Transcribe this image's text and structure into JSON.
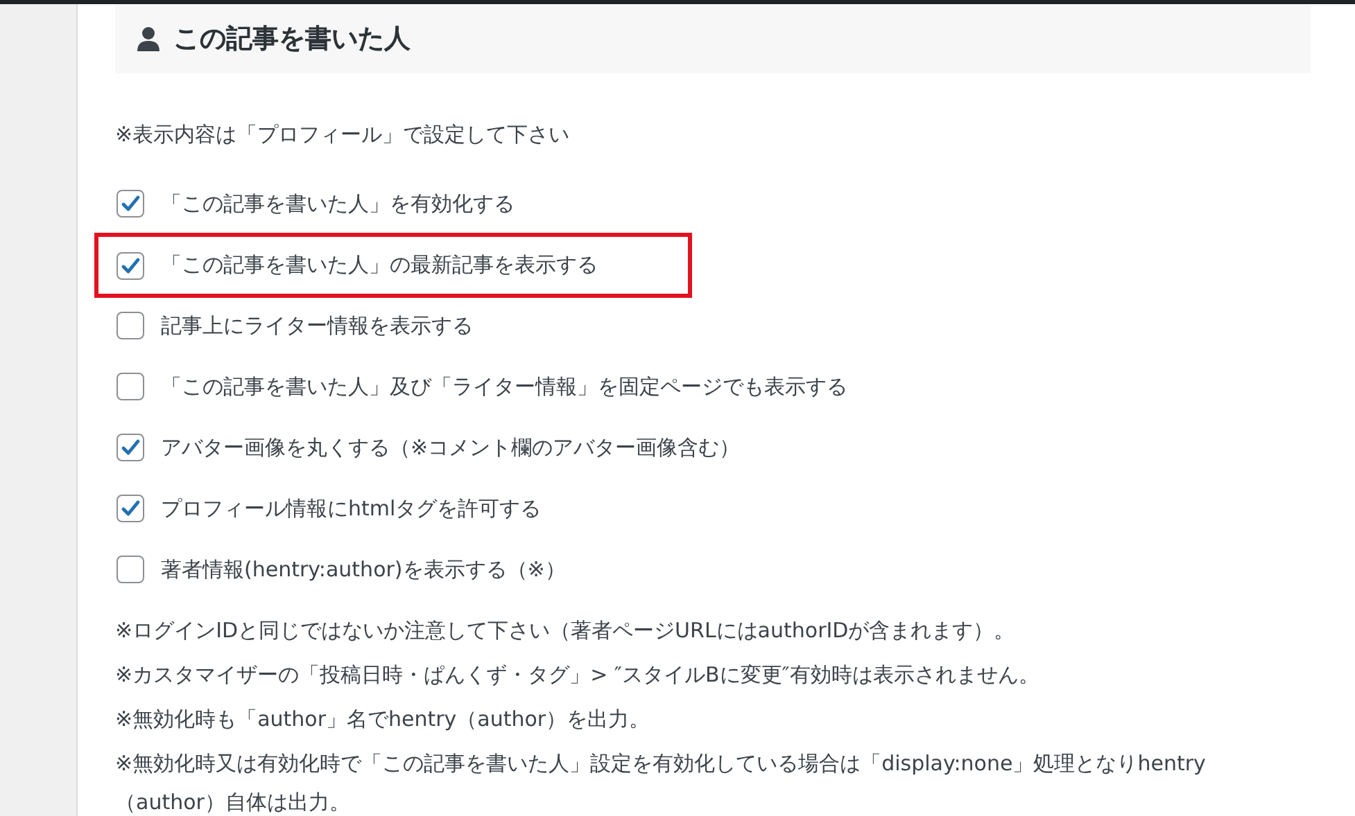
{
  "section": {
    "title": "この記事を書いた人"
  },
  "intro_note": "※表示内容は「プロフィール」で設定して下さい",
  "options": [
    {
      "label": "「この記事を書いた人」を有効化する",
      "checked": true,
      "highlighted": false
    },
    {
      "label": "「この記事を書いた人」の最新記事を表示する",
      "checked": true,
      "highlighted": true
    },
    {
      "label": "記事上にライター情報を表示する",
      "checked": false,
      "highlighted": false
    },
    {
      "label": "「この記事を書いた人」及び「ライター情報」を固定ページでも表示する",
      "checked": false,
      "highlighted": false
    },
    {
      "label": "アバター画像を丸くする（※コメント欄のアバター画像含む）",
      "checked": true,
      "highlighted": false
    },
    {
      "label": "プロフィール情報にhtmlタグを許可する",
      "checked": true,
      "highlighted": false
    },
    {
      "label": "著者情報(hentry:author)を表示する（※）",
      "checked": false,
      "highlighted": false
    }
  ],
  "notes": [
    "※ログインIDと同じではないか注意して下さい（著者ページURLにはauthorIDが含まれます）。",
    "※カスタマイザーの「投稿日時・ぱんくず・タグ」> ″スタイルBに変更″有効時は表示されません。",
    "※無効化時も「author」名でhentry（author）を出力。",
    "※無効化時又は有効化時で「この記事を書いた人」設定を有効化している場合は「display:none」処理となりhentry（author）自体は出力。"
  ]
}
